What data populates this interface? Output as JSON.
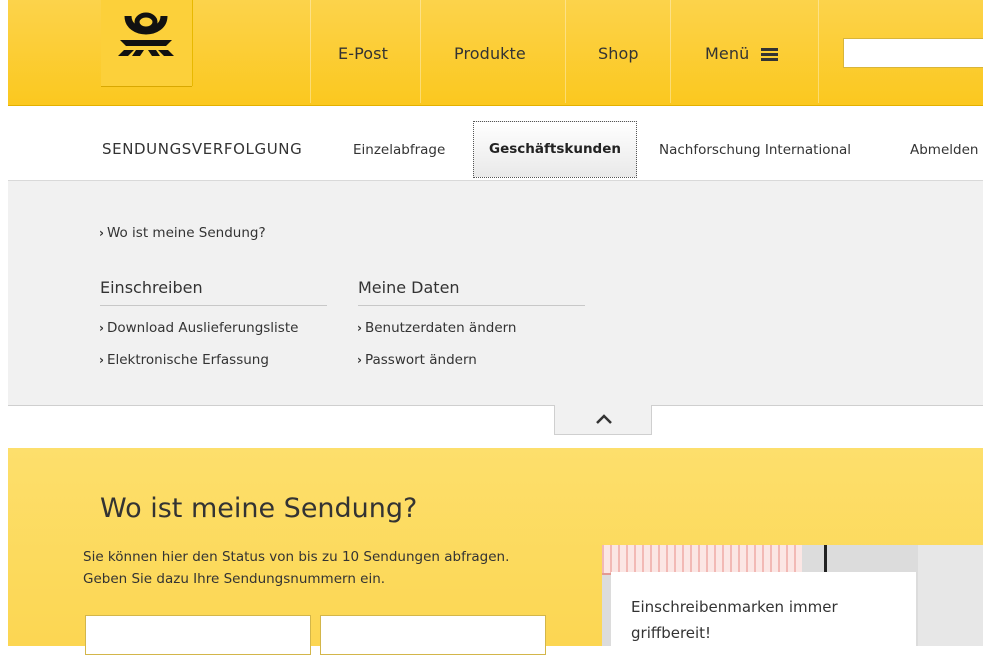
{
  "header": {
    "logo_icon": "posthorn-icon",
    "nav": [
      {
        "label": "E-Post"
      },
      {
        "label": "Produkte"
      },
      {
        "label": "Shop"
      },
      {
        "label": "Menü"
      }
    ],
    "search": {
      "placeholder": "",
      "value": ""
    },
    "colors": {
      "brand_yellow": "#fcc819",
      "text": "#333333"
    }
  },
  "subnav": {
    "title": "SENDUNGSVERFOLGUNG",
    "links": [
      "Einzelabfrage",
      "Geschäftskunden",
      "Nachforschung International",
      "Abmelden"
    ],
    "active": "Geschäftskunden"
  },
  "dropdown": {
    "top_link": "Wo ist meine Sendung?",
    "columns": [
      {
        "heading": "Einschreiben",
        "links": [
          "Download Auslieferungsliste",
          "Elektronische Erfassung"
        ]
      },
      {
        "heading": "Meine Daten",
        "links": [
          "Benutzerdaten ändern",
          "Passwort ändern"
        ]
      }
    ],
    "collapse_icon": "chevron-up-icon"
  },
  "main": {
    "title": "Wo ist meine Sendung?",
    "description_line1": "Sie können hier den Status von bis zu 10 Sendungen abfragen.",
    "description_line2": "Geben Sie dazu Ihre Sendungsnummern ein.",
    "inputs": [
      {
        "value": ""
      },
      {
        "value": ""
      }
    ]
  },
  "promo": {
    "text": "Einschreibenmarken immer griffbereit!"
  }
}
